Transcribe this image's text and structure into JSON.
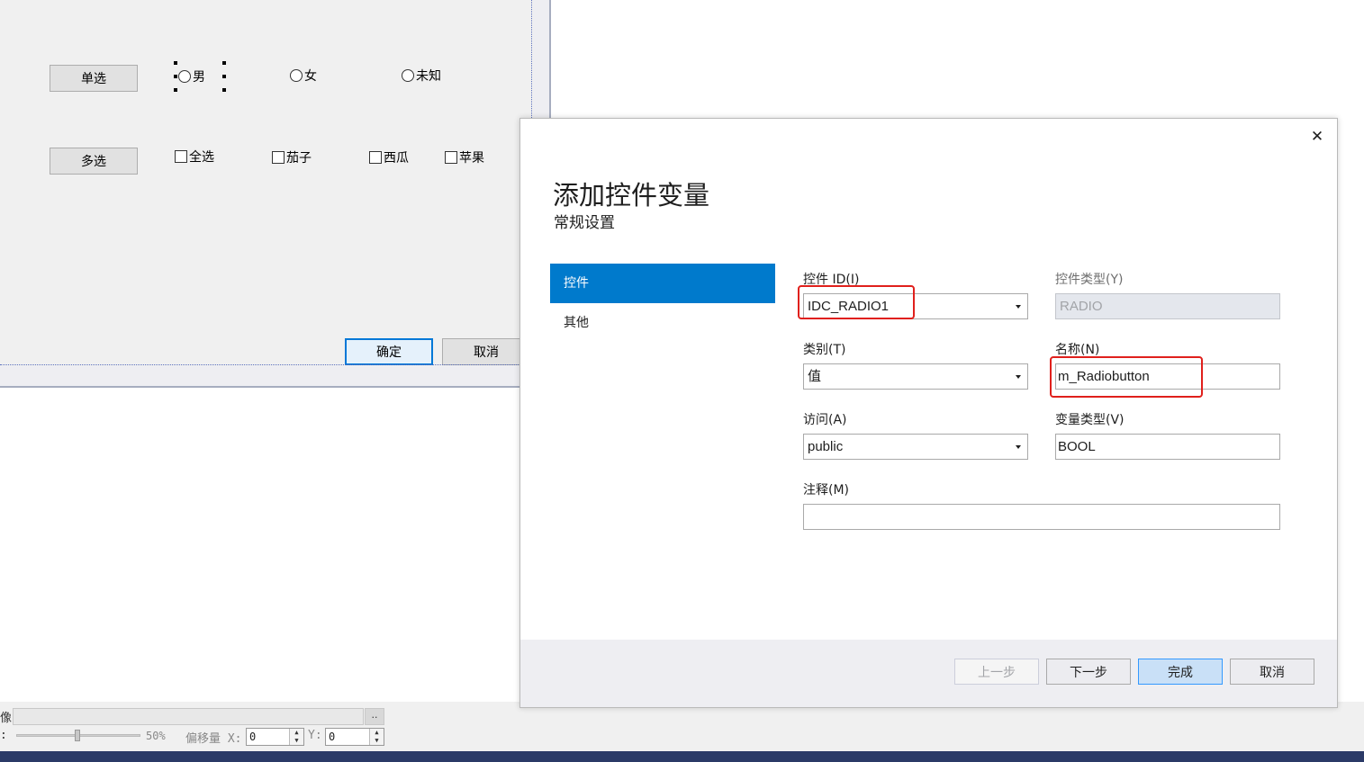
{
  "designer": {
    "single_button": "单选",
    "multi_button": "多选",
    "radios": [
      "男",
      "女",
      "未知"
    ],
    "checkboxes": [
      "全选",
      "茄子",
      "西瓜",
      "苹果"
    ],
    "ok_button": "确定",
    "cancel_button": "取消"
  },
  "status_strip": {
    "row1_label": "像:",
    "ellipsis": "..",
    "row2_label": ":",
    "zoom": "50%",
    "offset_x_label": "偏移量 X:",
    "offset_x_value": "0",
    "offset_y_label": "Y:",
    "offset_y_value": "0"
  },
  "dialog": {
    "close_icon": "close-icon",
    "title": "添加控件变量",
    "subtitle": "常规设置",
    "nav": [
      {
        "label": "控件",
        "active": true
      },
      {
        "label": "其他",
        "active": false
      }
    ],
    "fields": {
      "control_id": {
        "label": "控件 ID(I)",
        "value": "IDC_RADIO1"
      },
      "control_type": {
        "label": "控件类型(Y)",
        "value": "RADIO"
      },
      "category": {
        "label": "类别(T)",
        "value": "值"
      },
      "name": {
        "label": "名称(N)",
        "value": "m_Radiobutton"
      },
      "access": {
        "label": "访问(A)",
        "value": "public"
      },
      "var_type": {
        "label": "变量类型(V)",
        "value": "BOOL"
      },
      "comment": {
        "label": "注释(M)",
        "value": ""
      }
    },
    "buttons": {
      "prev": "上一步",
      "next": "下一步",
      "finish": "完成",
      "cancel": "取消"
    }
  },
  "colors": {
    "accent": "#007acc",
    "highlight": "#e0201c"
  }
}
